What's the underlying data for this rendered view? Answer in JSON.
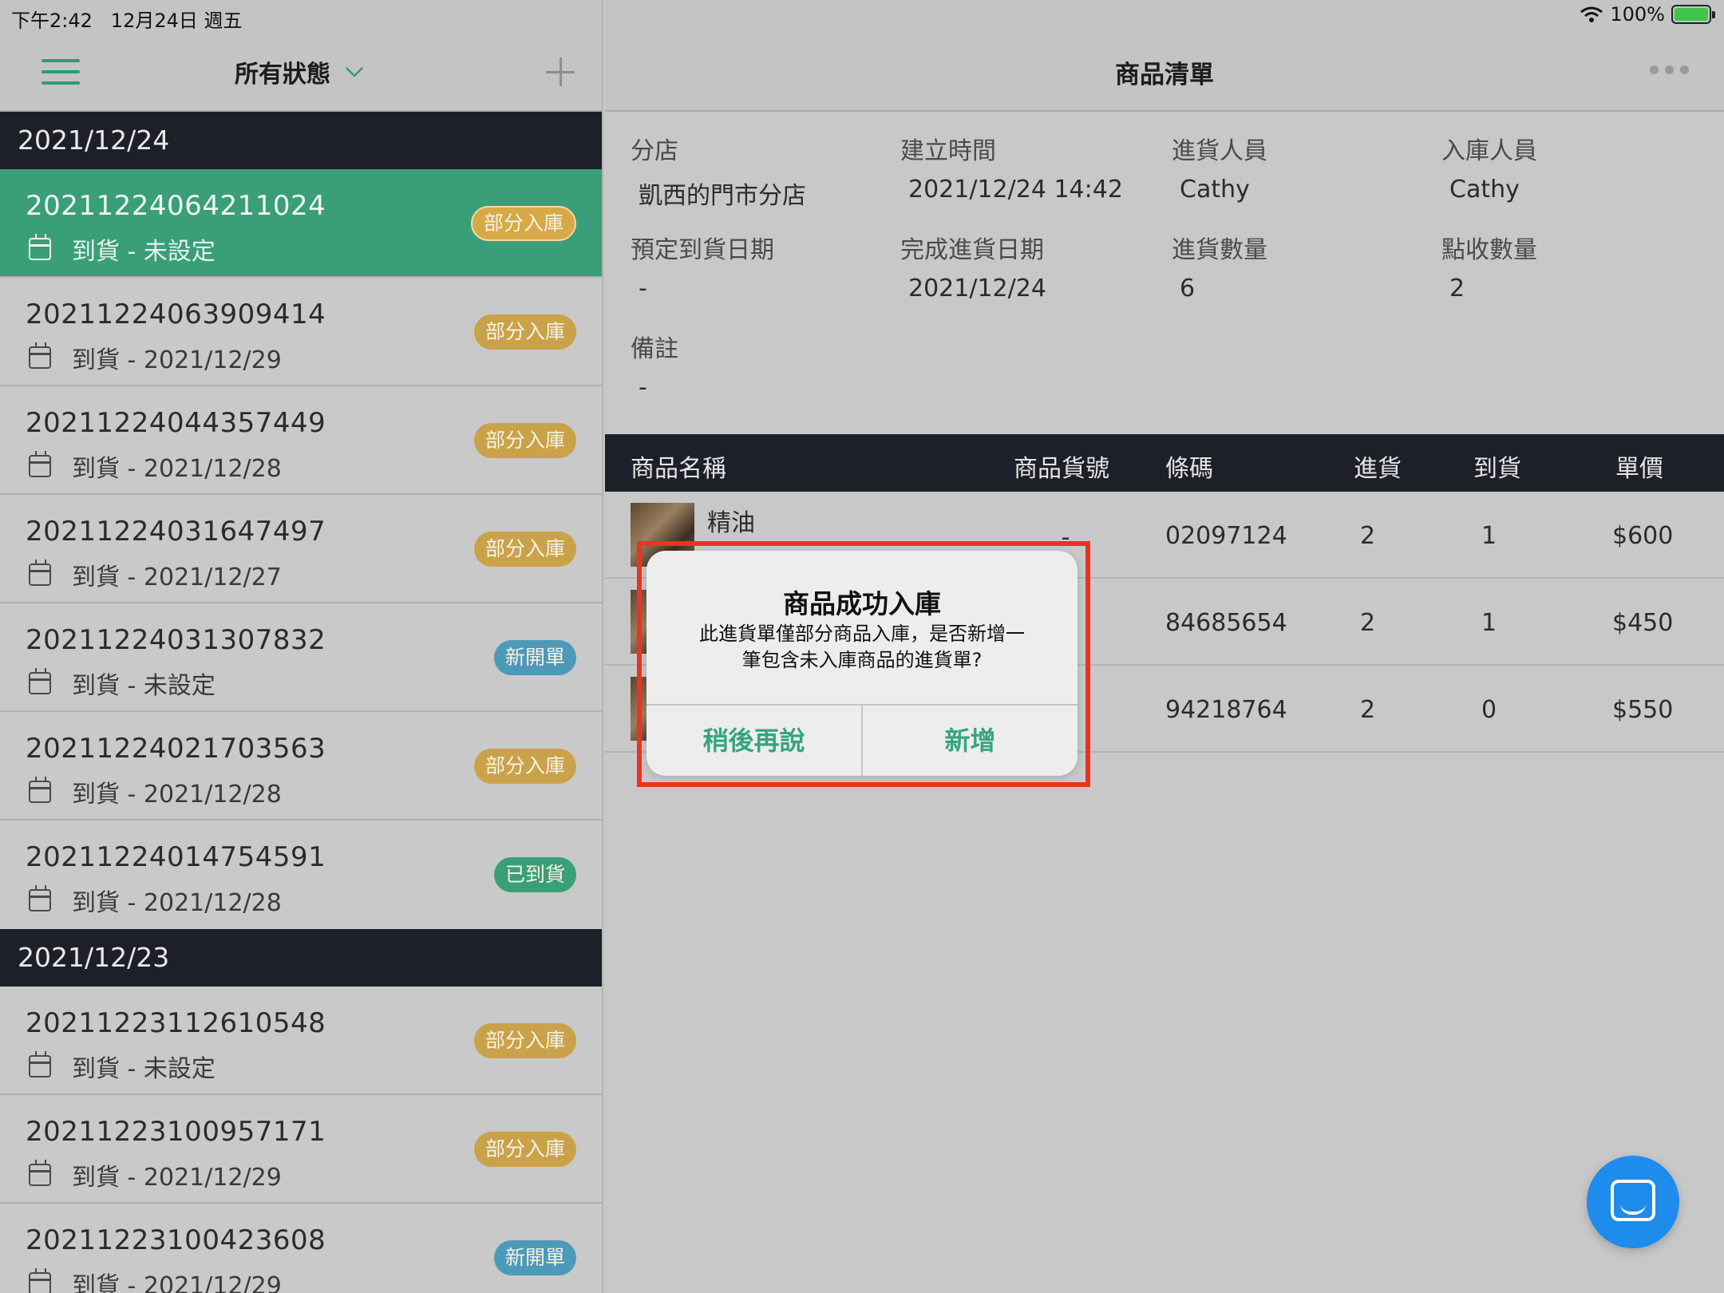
{
  "status_bar": {
    "time": "下午2:42",
    "date": "12月24日 週五",
    "battery": "100%"
  },
  "left": {
    "filter_label": "所有狀態",
    "groups": [
      {
        "date": "2021/12/24",
        "orders": [
          {
            "id": "20211224064211024",
            "arrival": "到貨 - 未設定",
            "status": "部分入庫"
          },
          {
            "id": "20211224063909414",
            "arrival": "到貨 - 2021/12/29",
            "status": "部分入庫"
          },
          {
            "id": "20211224044357449",
            "arrival": "到貨 - 2021/12/28",
            "status": "部分入庫"
          },
          {
            "id": "20211224031647497",
            "arrival": "到貨 - 2021/12/27",
            "status": "部分入庫"
          },
          {
            "id": "20211224031307832",
            "arrival": "到貨 - 未設定",
            "status": "新開單"
          },
          {
            "id": "20211224021703563",
            "arrival": "到貨 - 2021/12/28",
            "status": "部分入庫"
          },
          {
            "id": "20211224014754591",
            "arrival": "到貨 - 2021/12/28",
            "status": "已到貨"
          }
        ]
      },
      {
        "date": "2021/12/23",
        "orders": [
          {
            "id": "20211223112610548",
            "arrival": "到貨 - 未設定",
            "status": "部分入庫"
          },
          {
            "id": "20211223100957171",
            "arrival": "到貨 - 2021/12/29",
            "status": "部分入庫"
          },
          {
            "id": "20211223100423608",
            "arrival": "到貨 - 2021/12/29",
            "status": "新開單"
          }
        ]
      }
    ]
  },
  "right": {
    "title": "商品清單",
    "info": {
      "branch_label": "分店",
      "branch_value": "凱西的門市分店",
      "created_label": "建立時間",
      "created_value": "2021/12/24 14:42",
      "purchaser_label": "進貨人員",
      "purchaser_value": "Cathy",
      "receiver_label": "入庫人員",
      "receiver_value": "Cathy",
      "eta_label": "預定到貨日期",
      "eta_value": "-",
      "done_label": "完成進貨日期",
      "done_value": "2021/12/24",
      "qty_label": "進貨數量",
      "qty_value": "6",
      "checked_label": "點收數量",
      "checked_value": "2",
      "note_label": "備註",
      "note_value": "-"
    },
    "table": {
      "headers": [
        "商品名稱",
        "商品貨號",
        "條碼",
        "進貨",
        "到貨",
        "單價"
      ],
      "rows": [
        {
          "name": "精油",
          "sku": "-",
          "barcode": "02097124",
          "ordered": "2",
          "arrived": "1",
          "price": "$600"
        },
        {
          "name": "",
          "sku": "",
          "barcode": "84685654",
          "ordered": "2",
          "arrived": "1",
          "price": "$450"
        },
        {
          "name": "",
          "sku": "",
          "barcode": "94218764",
          "ordered": "2",
          "arrived": "0",
          "price": "$550"
        }
      ]
    }
  },
  "dialog": {
    "title": "商品成功入庫",
    "message_line1": "此進貨單僅部分商品入庫，是否新增一",
    "message_line2": "筆包含未入庫商品的進貨單?",
    "later_button": "稍後再說",
    "add_button": "新增"
  },
  "colors": {
    "accent": "#3a9f78",
    "dark_header": "#1e2029",
    "partial": "#c9a24a",
    "new": "#4c9ab7",
    "highlight": "#ea3323",
    "fab": "#1d8cec"
  },
  "icons": [
    "menu-icon",
    "chevron-down-icon",
    "plus-icon",
    "calendar-icon",
    "more-icon",
    "wifi-icon",
    "battery-icon",
    "chat-icon"
  ]
}
